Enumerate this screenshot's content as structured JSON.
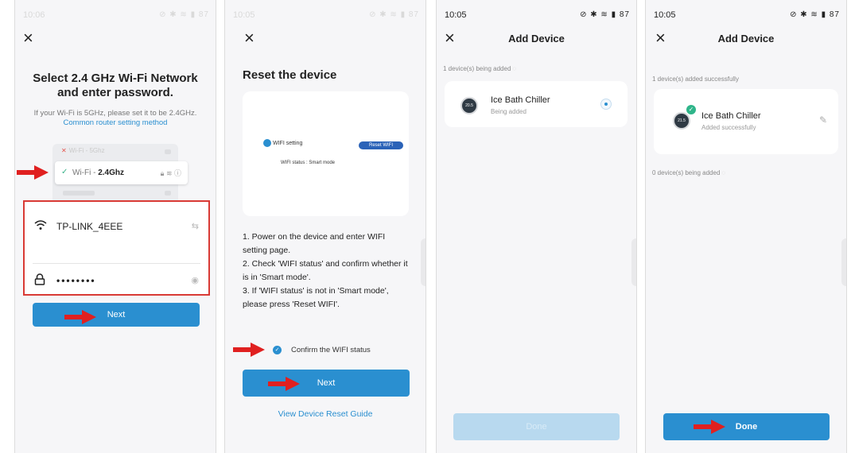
{
  "panel1": {
    "status_time": "10:06",
    "status_icons": "⊘ ✱ ≋ ▮ 87",
    "title": "Select 2.4 GHz Wi-Fi Network and enter password.",
    "subtitle": "If your Wi-Fi is 5GHz, please set it to be 2.4GHz.",
    "subtitle_link": "Common router setting method",
    "wifi_5g": "Wi-Fi - 5Ghz",
    "wifi_24_prefix": "Wi-Fi - ",
    "wifi_24_bold": "2.4Ghz",
    "ssid": "TP-LINK_4EEE",
    "password": "••••••••",
    "next_label": "Next"
  },
  "panel2": {
    "status_time": "10:05",
    "status_icons": "⊘ ✱ ≋ ▮ 87",
    "title": "Reset the device",
    "card_wifi_setting": "WIFI setting",
    "card_reset_wifi": "Reset WIFI",
    "card_wifi_status": "WIFI status : Smart mode",
    "steps": [
      "1. Power on the device and enter WIFI setting page.",
      "2. Check 'WIFI status' and confirm whether it is in 'Smart mode'.",
      "3. If 'WIFI status' is not in 'Smart mode', please press 'Reset WIFI'."
    ],
    "confirm_label": "Confirm the WIFI status",
    "next_label": "Next",
    "guide_link": "View Device Reset Guide"
  },
  "panel3": {
    "status_time": "10:05",
    "status_icons": "⊘ ✱ ≋ ▮ 87",
    "title": "Add Device",
    "progress_text": "1 device(s) being added",
    "device_name": "Ice Bath Chiller",
    "device_state": "Being added",
    "device_display": "20.5",
    "done_label": "Done"
  },
  "panel4": {
    "status_time": "10:05",
    "status_icons": "⊘ ✱ ≋ ▮ 87",
    "title": "Add Device",
    "success_text": "1 device(s) added successfully",
    "device_name": "Ice Bath Chiller",
    "device_state": "Added successfully",
    "device_display": "21.5",
    "pending_text": "0 device(s) being added",
    "done_label": "Done"
  },
  "colors": {
    "accent": "#2a8fd0",
    "highlight_red": "#d93a35",
    "success_green": "#2fb58a"
  },
  "icons": [
    "close-icon",
    "wifi-icon",
    "lock-icon",
    "eye-icon",
    "swap-icon",
    "check-icon",
    "edit-icon",
    "red-arrow-icon"
  ]
}
